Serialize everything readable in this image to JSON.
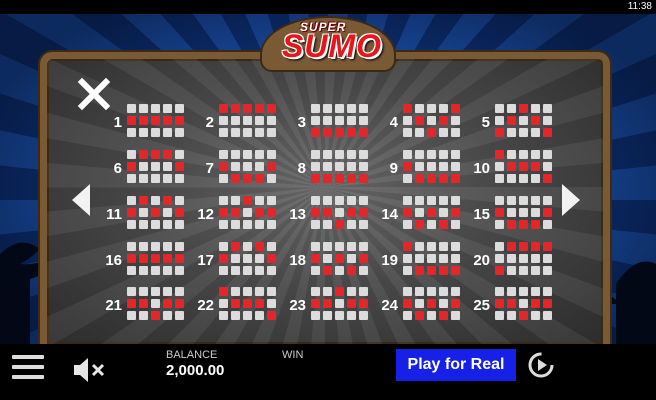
{
  "status_bar": {
    "time": "11:38"
  },
  "logo": {
    "super": "SUPER",
    "sumo": "SUMO"
  },
  "paylines": [
    {
      "number": "1",
      "pattern": [
        [
          0,
          0,
          0,
          0,
          0
        ],
        [
          1,
          1,
          1,
          1,
          1
        ],
        [
          0,
          0,
          0,
          0,
          0
        ]
      ]
    },
    {
      "number": "2",
      "pattern": [
        [
          1,
          1,
          1,
          1,
          1
        ],
        [
          0,
          0,
          0,
          0,
          0
        ],
        [
          0,
          0,
          0,
          0,
          0
        ]
      ]
    },
    {
      "number": "3",
      "pattern": [
        [
          0,
          0,
          0,
          0,
          0
        ],
        [
          0,
          0,
          0,
          0,
          0
        ],
        [
          1,
          1,
          1,
          1,
          1
        ]
      ]
    },
    {
      "number": "4",
      "pattern": [
        [
          1,
          0,
          0,
          0,
          1
        ],
        [
          0,
          1,
          0,
          1,
          0
        ],
        [
          0,
          0,
          1,
          0,
          0
        ]
      ]
    },
    {
      "number": "5",
      "pattern": [
        [
          0,
          0,
          1,
          0,
          0
        ],
        [
          0,
          1,
          0,
          1,
          0
        ],
        [
          1,
          0,
          0,
          0,
          1
        ]
      ]
    },
    {
      "number": "6",
      "pattern": [
        [
          0,
          1,
          1,
          1,
          0
        ],
        [
          1,
          0,
          0,
          0,
          1
        ],
        [
          0,
          0,
          0,
          0,
          0
        ]
      ]
    },
    {
      "number": "7",
      "pattern": [
        [
          0,
          0,
          0,
          0,
          0
        ],
        [
          1,
          0,
          0,
          0,
          1
        ],
        [
          0,
          1,
          1,
          1,
          0
        ]
      ]
    },
    {
      "number": "8",
      "pattern": [
        [
          0,
          0,
          0,
          0,
          0
        ],
        [
          0,
          0,
          0,
          0,
          0
        ],
        [
          1,
          1,
          1,
          1,
          1
        ]
      ]
    },
    {
      "number": "9",
      "pattern": [
        [
          0,
          0,
          0,
          0,
          0
        ],
        [
          1,
          0,
          0,
          0,
          0
        ],
        [
          0,
          1,
          1,
          1,
          1
        ]
      ]
    },
    {
      "number": "10",
      "pattern": [
        [
          1,
          0,
          0,
          0,
          0
        ],
        [
          0,
          1,
          1,
          1,
          0
        ],
        [
          0,
          0,
          0,
          0,
          1
        ]
      ]
    },
    {
      "number": "11",
      "pattern": [
        [
          0,
          1,
          0,
          1,
          0
        ],
        [
          1,
          0,
          1,
          0,
          1
        ],
        [
          0,
          0,
          0,
          0,
          0
        ]
      ]
    },
    {
      "number": "12",
      "pattern": [
        [
          0,
          0,
          1,
          0,
          0
        ],
        [
          1,
          1,
          0,
          1,
          1
        ],
        [
          0,
          0,
          0,
          0,
          0
        ]
      ]
    },
    {
      "number": "13",
      "pattern": [
        [
          0,
          0,
          0,
          0,
          0
        ],
        [
          1,
          1,
          0,
          1,
          1
        ],
        [
          0,
          0,
          1,
          0,
          0
        ]
      ]
    },
    {
      "number": "14",
      "pattern": [
        [
          0,
          0,
          0,
          0,
          0
        ],
        [
          1,
          0,
          1,
          0,
          1
        ],
        [
          0,
          1,
          0,
          1,
          0
        ]
      ]
    },
    {
      "number": "15",
      "pattern": [
        [
          0,
          0,
          0,
          0,
          0
        ],
        [
          1,
          0,
          0,
          0,
          1
        ],
        [
          0,
          1,
          1,
          1,
          0
        ]
      ]
    },
    {
      "number": "16",
      "pattern": [
        [
          0,
          0,
          0,
          0,
          0
        ],
        [
          1,
          1,
          1,
          1,
          1
        ],
        [
          0,
          0,
          0,
          0,
          0
        ]
      ]
    },
    {
      "number": "17",
      "pattern": [
        [
          0,
          1,
          0,
          1,
          0
        ],
        [
          1,
          0,
          0,
          0,
          1
        ],
        [
          0,
          0,
          0,
          0,
          0
        ]
      ]
    },
    {
      "number": "18",
      "pattern": [
        [
          0,
          0,
          0,
          0,
          0
        ],
        [
          1,
          0,
          1,
          0,
          1
        ],
        [
          0,
          1,
          0,
          1,
          0
        ]
      ]
    },
    {
      "number": "19",
      "pattern": [
        [
          1,
          0,
          0,
          0,
          0
        ],
        [
          0,
          0,
          0,
          0,
          0
        ],
        [
          0,
          1,
          1,
          1,
          1
        ]
      ]
    },
    {
      "number": "20",
      "pattern": [
        [
          0,
          1,
          1,
          1,
          1
        ],
        [
          0,
          0,
          0,
          0,
          0
        ],
        [
          1,
          0,
          0,
          0,
          0
        ]
      ]
    },
    {
      "number": "21",
      "pattern": [
        [
          0,
          0,
          0,
          0,
          0
        ],
        [
          1,
          1,
          0,
          1,
          1
        ],
        [
          0,
          0,
          1,
          0,
          0
        ]
      ]
    },
    {
      "number": "22",
      "pattern": [
        [
          1,
          0,
          0,
          0,
          0
        ],
        [
          0,
          1,
          1,
          1,
          0
        ],
        [
          0,
          0,
          0,
          0,
          1
        ]
      ]
    },
    {
      "number": "23",
      "pattern": [
        [
          0,
          0,
          1,
          0,
          0
        ],
        [
          1,
          1,
          0,
          1,
          1
        ],
        [
          0,
          0,
          0,
          0,
          0
        ]
      ]
    },
    {
      "number": "24",
      "pattern": [
        [
          0,
          0,
          0,
          0,
          0
        ],
        [
          1,
          0,
          1,
          0,
          1
        ],
        [
          0,
          1,
          0,
          1,
          0
        ]
      ]
    },
    {
      "number": "25",
      "pattern": [
        [
          0,
          0,
          0,
          0,
          0
        ],
        [
          1,
          1,
          0,
          1,
          1
        ],
        [
          0,
          0,
          1,
          0,
          0
        ]
      ]
    }
  ],
  "bottom_bar": {
    "menu_icon": "hamburger-icon",
    "sound_icon": "speaker-muted-icon",
    "balance_label": "BALANCE",
    "balance_value": "2,000.00",
    "win_label": "WIN",
    "play_label": "Play for Real",
    "autoplay_icon": "autoplay-icon"
  },
  "colors": {
    "active_cell": "#e4262b",
    "inactive_cell": "#dcdcdc",
    "play_button": "#1620e6",
    "background_ray_light": "#1d57b8",
    "background_ray_dark": "#0f3680",
    "frame_wood": "#7a5a35"
  }
}
